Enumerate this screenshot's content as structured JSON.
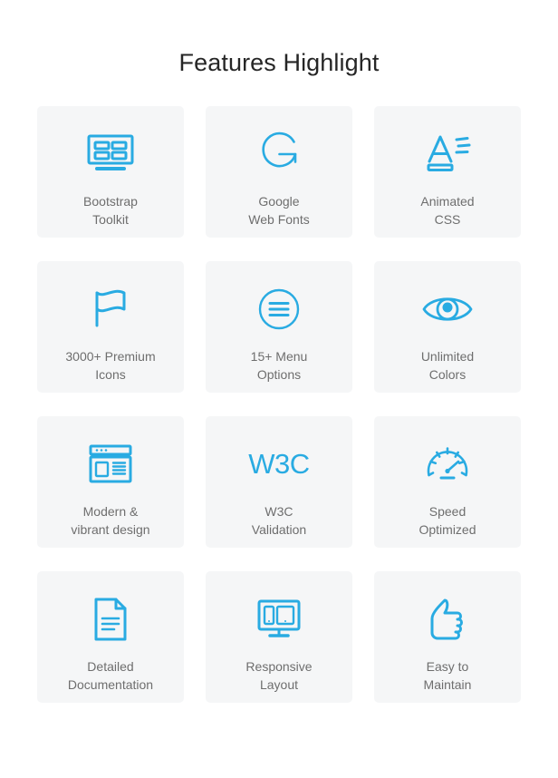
{
  "header": {
    "title": "Features Highlight"
  },
  "theme": {
    "accent": "#29abe2",
    "card_bg": "#f5f6f7",
    "page_bg": "#ffffff",
    "label_color": "#6e6e6e",
    "title_color": "#262626"
  },
  "features": [
    {
      "icon": "bootstrap-grid-icon",
      "label": "Bootstrap\nToolkit"
    },
    {
      "icon": "google-g-icon",
      "label": "Google\nWeb Fonts"
    },
    {
      "icon": "animated-letter-a-icon",
      "label": "Animated\nCSS"
    },
    {
      "icon": "flag-icon",
      "label": "3000+ Premium\nIcons"
    },
    {
      "icon": "hamburger-menu-circle-icon",
      "label": "15+ Menu\nOptions"
    },
    {
      "icon": "eye-icon",
      "label": "Unlimited\nColors"
    },
    {
      "icon": "browser-layout-icon",
      "label": "Modern &\nvibrant design"
    },
    {
      "icon": "w3c-text-icon",
      "label": "W3C\nValidation",
      "icon_text": "W3C"
    },
    {
      "icon": "speedometer-icon",
      "label": "Speed\nOptimized"
    },
    {
      "icon": "document-icon",
      "label": "Detailed\nDocumentation"
    },
    {
      "icon": "responsive-devices-icon",
      "label": "Responsive\nLayout"
    },
    {
      "icon": "thumbs-up-icon",
      "label": "Easy to\nMaintain"
    }
  ]
}
